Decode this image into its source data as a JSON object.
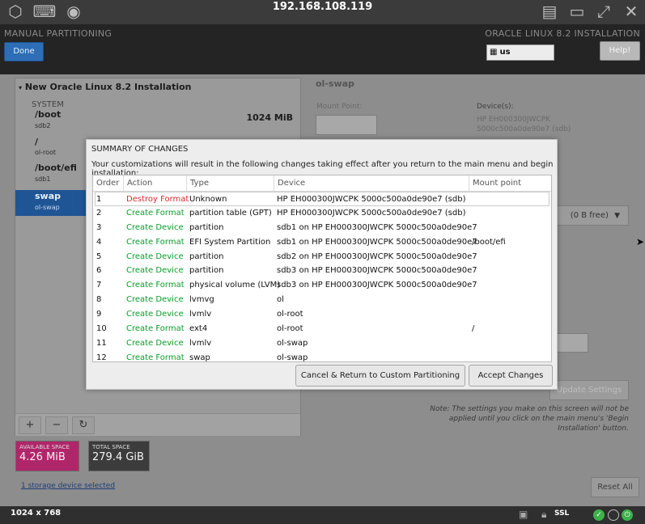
{
  "viewer": {
    "title": "192.168.108.119",
    "resolution": "1024 x 768",
    "ssl_label": "SSL",
    "icons": [
      "cube-icon",
      "keyboard-icon",
      "record-icon",
      "layout-icon",
      "window-icon",
      "fullscreen-icon",
      "close-icon"
    ]
  },
  "header": {
    "left_title": "MANUAL PARTITIONING",
    "done_label": "Done",
    "right_title": "ORACLE LINUX 8.2 INSTALLATION",
    "keyboard_layout": "us",
    "help_label": "Help!"
  },
  "left_panel": {
    "install_title": "New Oracle Linux 8.2 Installation",
    "system_label": "SYSTEM",
    "mounts": [
      {
        "mount": "/boot",
        "device": "sdb2",
        "size": "1024 MiB"
      },
      {
        "mount": "/",
        "device": "ol-root",
        "size": ""
      },
      {
        "mount": "/boot/efi",
        "device": "sdb1",
        "size": ""
      },
      {
        "mount": "swap",
        "device": "ol-swap",
        "size": ""
      }
    ],
    "add_label": "+",
    "remove_label": "−",
    "refresh_label": "↻",
    "available_space": {
      "label": "AVAILABLE SPACE",
      "value": "4.26 MiB"
    },
    "total_space": {
      "label": "TOTAL SPACE",
      "value": "279.4 GiB"
    },
    "storage_link": "1 storage device selected"
  },
  "right_panel": {
    "title": "ol-swap",
    "mount_point_label": "Mount Point:",
    "devices_label": "Device(s):",
    "devices_value_1": "HP EH000300JWCPK",
    "devices_value_2": "5000c500a0de90e7 (sdb)",
    "free_label": "(0 B free)",
    "update_label": "Update Settings",
    "note": "Note:  The settings you make on this screen will not be applied until you click on the main menu's 'Begin Installation' button.",
    "reset_label": "Reset All"
  },
  "modal": {
    "title": "SUMMARY OF CHANGES",
    "description": "Your customizations will result in the following changes taking effect after you return to the main menu and begin installation:",
    "columns": [
      "Order",
      "Action",
      "Type",
      "Device",
      "Mount point"
    ],
    "rows": [
      {
        "order": "1",
        "action": "Destroy Format",
        "kind": "destroy",
        "type": "Unknown",
        "device": "HP EH000300JWCPK 5000c500a0de90e7 (sdb)",
        "mount": ""
      },
      {
        "order": "2",
        "action": "Create Format",
        "kind": "create",
        "type": "partition table (GPT)",
        "device": "HP EH000300JWCPK 5000c500a0de90e7 (sdb)",
        "mount": ""
      },
      {
        "order": "3",
        "action": "Create Device",
        "kind": "create",
        "type": "partition",
        "device": "sdb1 on HP EH000300JWCPK 5000c500a0de90e7",
        "mount": ""
      },
      {
        "order": "4",
        "action": "Create Format",
        "kind": "create",
        "type": "EFI System Partition",
        "device": "sdb1 on HP EH000300JWCPK 5000c500a0de90e7",
        "mount": "/boot/efi"
      },
      {
        "order": "5",
        "action": "Create Device",
        "kind": "create",
        "type": "partition",
        "device": "sdb2 on HP EH000300JWCPK 5000c500a0de90e7",
        "mount": ""
      },
      {
        "order": "6",
        "action": "Create Device",
        "kind": "create",
        "type": "partition",
        "device": "sdb3 on HP EH000300JWCPK 5000c500a0de90e7",
        "mount": ""
      },
      {
        "order": "7",
        "action": "Create Format",
        "kind": "create",
        "type": "physical volume (LVM)",
        "device": "sdb3 on HP EH000300JWCPK 5000c500a0de90e7",
        "mount": ""
      },
      {
        "order": "8",
        "action": "Create Device",
        "kind": "create",
        "type": "lvmvg",
        "device": "ol",
        "mount": ""
      },
      {
        "order": "9",
        "action": "Create Device",
        "kind": "create",
        "type": "lvmlv",
        "device": "ol-root",
        "mount": ""
      },
      {
        "order": "10",
        "action": "Create Format",
        "kind": "create",
        "type": "ext4",
        "device": "ol-root",
        "mount": "/"
      },
      {
        "order": "11",
        "action": "Create Device",
        "kind": "create",
        "type": "lvmlv",
        "device": "ol-swap",
        "mount": ""
      },
      {
        "order": "12",
        "action": "Create Format",
        "kind": "create",
        "type": "swap",
        "device": "ol-swap",
        "mount": ""
      }
    ],
    "cancel_label": "Cancel & Return to Custom Partitioning",
    "accept_label": "Accept Changes"
  },
  "colors": {
    "accent_blue": "#2e6eb7",
    "destroy_red": "#d62b2b",
    "create_green": "#0d9a2c",
    "available_space_bg": "#b0266a",
    "status_green": "#3db24b"
  }
}
